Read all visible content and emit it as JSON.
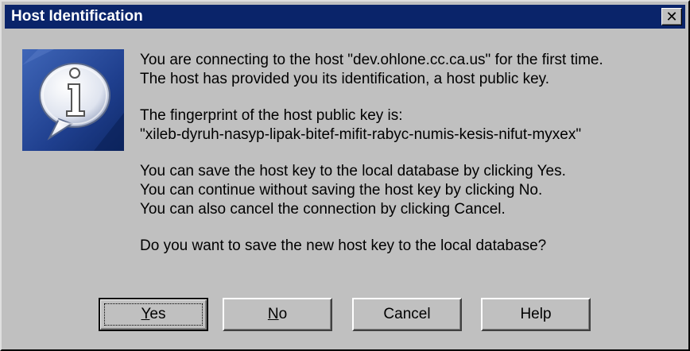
{
  "window": {
    "title": "Host Identification",
    "close_glyph": "✕"
  },
  "icon": {
    "name": "info-icon"
  },
  "message": {
    "lines_1": [
      "You are connecting to the host \"dev.ohlone.cc.ca.us\" for the first time.",
      "The host has provided you its identification, a host public key."
    ],
    "lines_2": [
      "The fingerprint of the host public key is:",
      "\"xileb-dyruh-nasyp-lipak-bitef-mifit-rabyc-numis-kesis-nifut-myxex\""
    ],
    "lines_3": [
      "You can save the host key to the local database by clicking Yes.",
      "You can continue without saving the host key by clicking No.",
      "You can also cancel the connection by clicking Cancel."
    ],
    "question": "Do you want to save the new host key to the local database?"
  },
  "buttons": {
    "yes": {
      "accel": "Y",
      "rest": "es"
    },
    "no": {
      "accel": "N",
      "rest": "o"
    },
    "cancel": "Cancel",
    "help": "Help"
  },
  "colors": {
    "titlebar": "#0a246a",
    "face": "#c0c0c0"
  }
}
